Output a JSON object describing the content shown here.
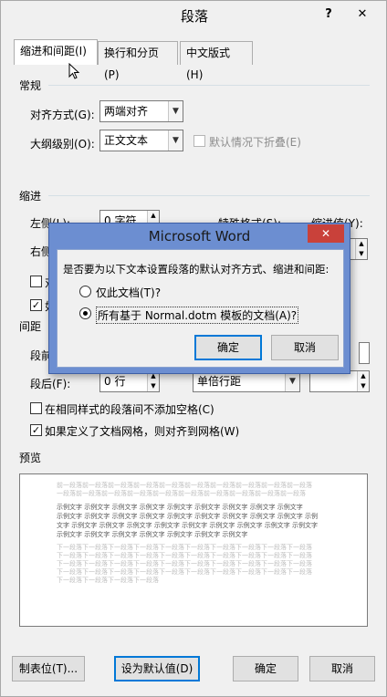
{
  "window": {
    "title": "段落",
    "help_label": "?",
    "close_label": "✕"
  },
  "tabs": [
    {
      "label": "缩进和间距(I)",
      "active": true
    },
    {
      "label": "换行和分页(P)",
      "active": false
    },
    {
      "label": "中文版式(H)",
      "active": false
    }
  ],
  "general": {
    "section_label": "常规",
    "alignment_label": "对齐方式(G):",
    "alignment_value": "两端对齐",
    "outline_label": "大纲级别(O):",
    "outline_value": "正文文本",
    "collapse_label": "默认情况下折叠(E)"
  },
  "indent": {
    "section_label": "缩进",
    "left_label": "左侧(L):",
    "left_value": "0 字符",
    "right_label": "右侧",
    "special_label": "特殊格式(S):",
    "indent_value_label": "缩进值(Y):",
    "partial_chk1": "对",
    "partial_chk2": "如"
  },
  "spacing": {
    "section_label": "间距",
    "before_label": "段前",
    "after_label": "段后(F):",
    "after_value": "0 行",
    "line_spacing_value": "单倍行距",
    "no_space_label": "在相同样式的段落间不添加空格(C)",
    "snap_grid_label": "如果定义了文档网格，则对齐到网格(W)",
    "no_space_checked": false,
    "snap_grid_checked": true
  },
  "preview": {
    "section_label": "预览",
    "prev_lines": [
      "前一段落前一段落前一段落前一段落前一段落前一段落前一段落前一段落前一段落前一段落",
      "一段落前一段落前一段落前一段落前一段落前一段落前一段落前一段落前一段落前一段落"
    ],
    "sample_lines": [
      "  示例文字 示例文字 示例文字 示例文字 示例文字 示例文字 示例文字 示例文字 示例文字",
      "示例文字 示例文字 示例文字 示例文字 示例文字 示例文字 示例文字 示例文字 示例文字 示例",
      "文字 示例文字 示例文字 示例文字 示例文字 示例文字 示例文字 示例文字 示例文字 示例文字",
      "示例文字 示例文字 示例文字 示例文字 示例文字 示例文字 示例文字"
    ],
    "next_lines": [
      "下一段落下一段落下一段落下一段落下一段落下一段落下一段落下一段落下一段落下一段落",
      "下一段落下一段落下一段落下一段落下一段落下一段落下一段落下一段落下一段落下一段落",
      "下一段落下一段落下一段落下一段落下一段落下一段落下一段落下一段落下一段落下一段落",
      "下一段落下一段落下一段落下一段落下一段落下一段落下一段落下一段落下一段落下一段落",
      "下一段落下一段落下一段落下一段落"
    ]
  },
  "buttons": {
    "tabs_label": "制表位(T)...",
    "set_default_label": "设为默认值(D)",
    "ok_label": "确定",
    "cancel_label": "取消"
  },
  "modal": {
    "title": "Microsoft Word",
    "close_label": "✕",
    "question": "是否要为以下文本设置段落的默认对齐方式、缩进和间距:",
    "option1": "仅此文档(T)?",
    "option2": "所有基于 Normal.dotm 模板的文档(A)?",
    "selected_option": 2,
    "ok_label": "确定",
    "cancel_label": "取消"
  },
  "colors": {
    "modal_frame": "#6c8ed1",
    "close_red": "#c9413a",
    "focus_blue": "#0078d7"
  }
}
